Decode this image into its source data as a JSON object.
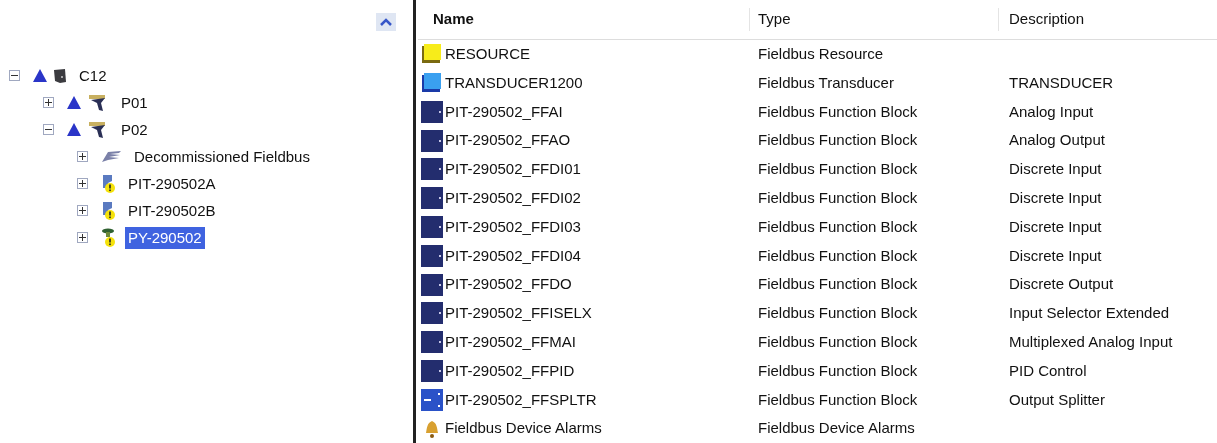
{
  "tree": [
    {
      "label": "C12",
      "kind": "controller",
      "expanded": true,
      "selected": false,
      "children": [
        {
          "label": "P01",
          "kind": "cell",
          "expanded": false,
          "selected": false
        },
        {
          "label": "P02",
          "kind": "cell",
          "expanded": true,
          "selected": false,
          "children": [
            {
              "label": "Decommissioned Fieldbus",
              "kind": "fieldbus",
              "expanded": false,
              "selected": false
            },
            {
              "label": "PIT-290502A",
              "kind": "transmitter",
              "expanded": false,
              "selected": false
            },
            {
              "label": "PIT-290502B",
              "kind": "transmitter",
              "expanded": false,
              "selected": false
            },
            {
              "label": "PY-290502",
              "kind": "valve",
              "expanded": false,
              "selected": true
            }
          ]
        }
      ]
    }
  ],
  "table": {
    "columns": [
      "Name",
      "Type",
      "Description"
    ],
    "rows": [
      {
        "kind": "resource",
        "name": "RESOURCE",
        "type": "Fieldbus Resource"
      },
      {
        "kind": "transducer",
        "name": "TRANSDUCER1200",
        "type": "Fieldbus Transducer",
        "description": "TRANSDUCER"
      },
      {
        "kind": "block",
        "name": "PIT-290502_FFAI",
        "type": "Fieldbus Function Block",
        "description": "Analog Input"
      },
      {
        "kind": "block",
        "name": "PIT-290502_FFAO",
        "type": "Fieldbus Function Block",
        "description": "Analog Output"
      },
      {
        "kind": "block",
        "name": "PIT-290502_FFDI01",
        "type": "Fieldbus Function Block",
        "description": "Discrete Input"
      },
      {
        "kind": "block",
        "name": "PIT-290502_FFDI02",
        "type": "Fieldbus Function Block",
        "description": "Discrete Input"
      },
      {
        "kind": "block",
        "name": "PIT-290502_FFDI03",
        "type": "Fieldbus Function Block",
        "description": "Discrete Input"
      },
      {
        "kind": "block",
        "name": "PIT-290502_FFDI04",
        "type": "Fieldbus Function Block",
        "description": "Discrete Input"
      },
      {
        "kind": "block",
        "name": "PIT-290502_FFDO",
        "type": "Fieldbus Function Block",
        "description": "Discrete Output"
      },
      {
        "kind": "block",
        "name": "PIT-290502_FFISELX",
        "type": "Fieldbus Function Block",
        "description": "Input Selector Extended"
      },
      {
        "kind": "block",
        "name": "PIT-290502_FFMAI",
        "type": "Fieldbus Function Block",
        "description": "Multiplexed Analog Input"
      },
      {
        "kind": "block",
        "name": "PIT-290502_FFPID",
        "type": "Fieldbus Function Block",
        "description": "PID Control"
      },
      {
        "kind": "splitter",
        "name": "PIT-290502_FFSPLTR",
        "type": "Fieldbus Function Block",
        "description": "Output Splitter"
      },
      {
        "kind": "alarms",
        "name": "Fieldbus Device Alarms",
        "type": "Fieldbus Device Alarms"
      }
    ]
  }
}
